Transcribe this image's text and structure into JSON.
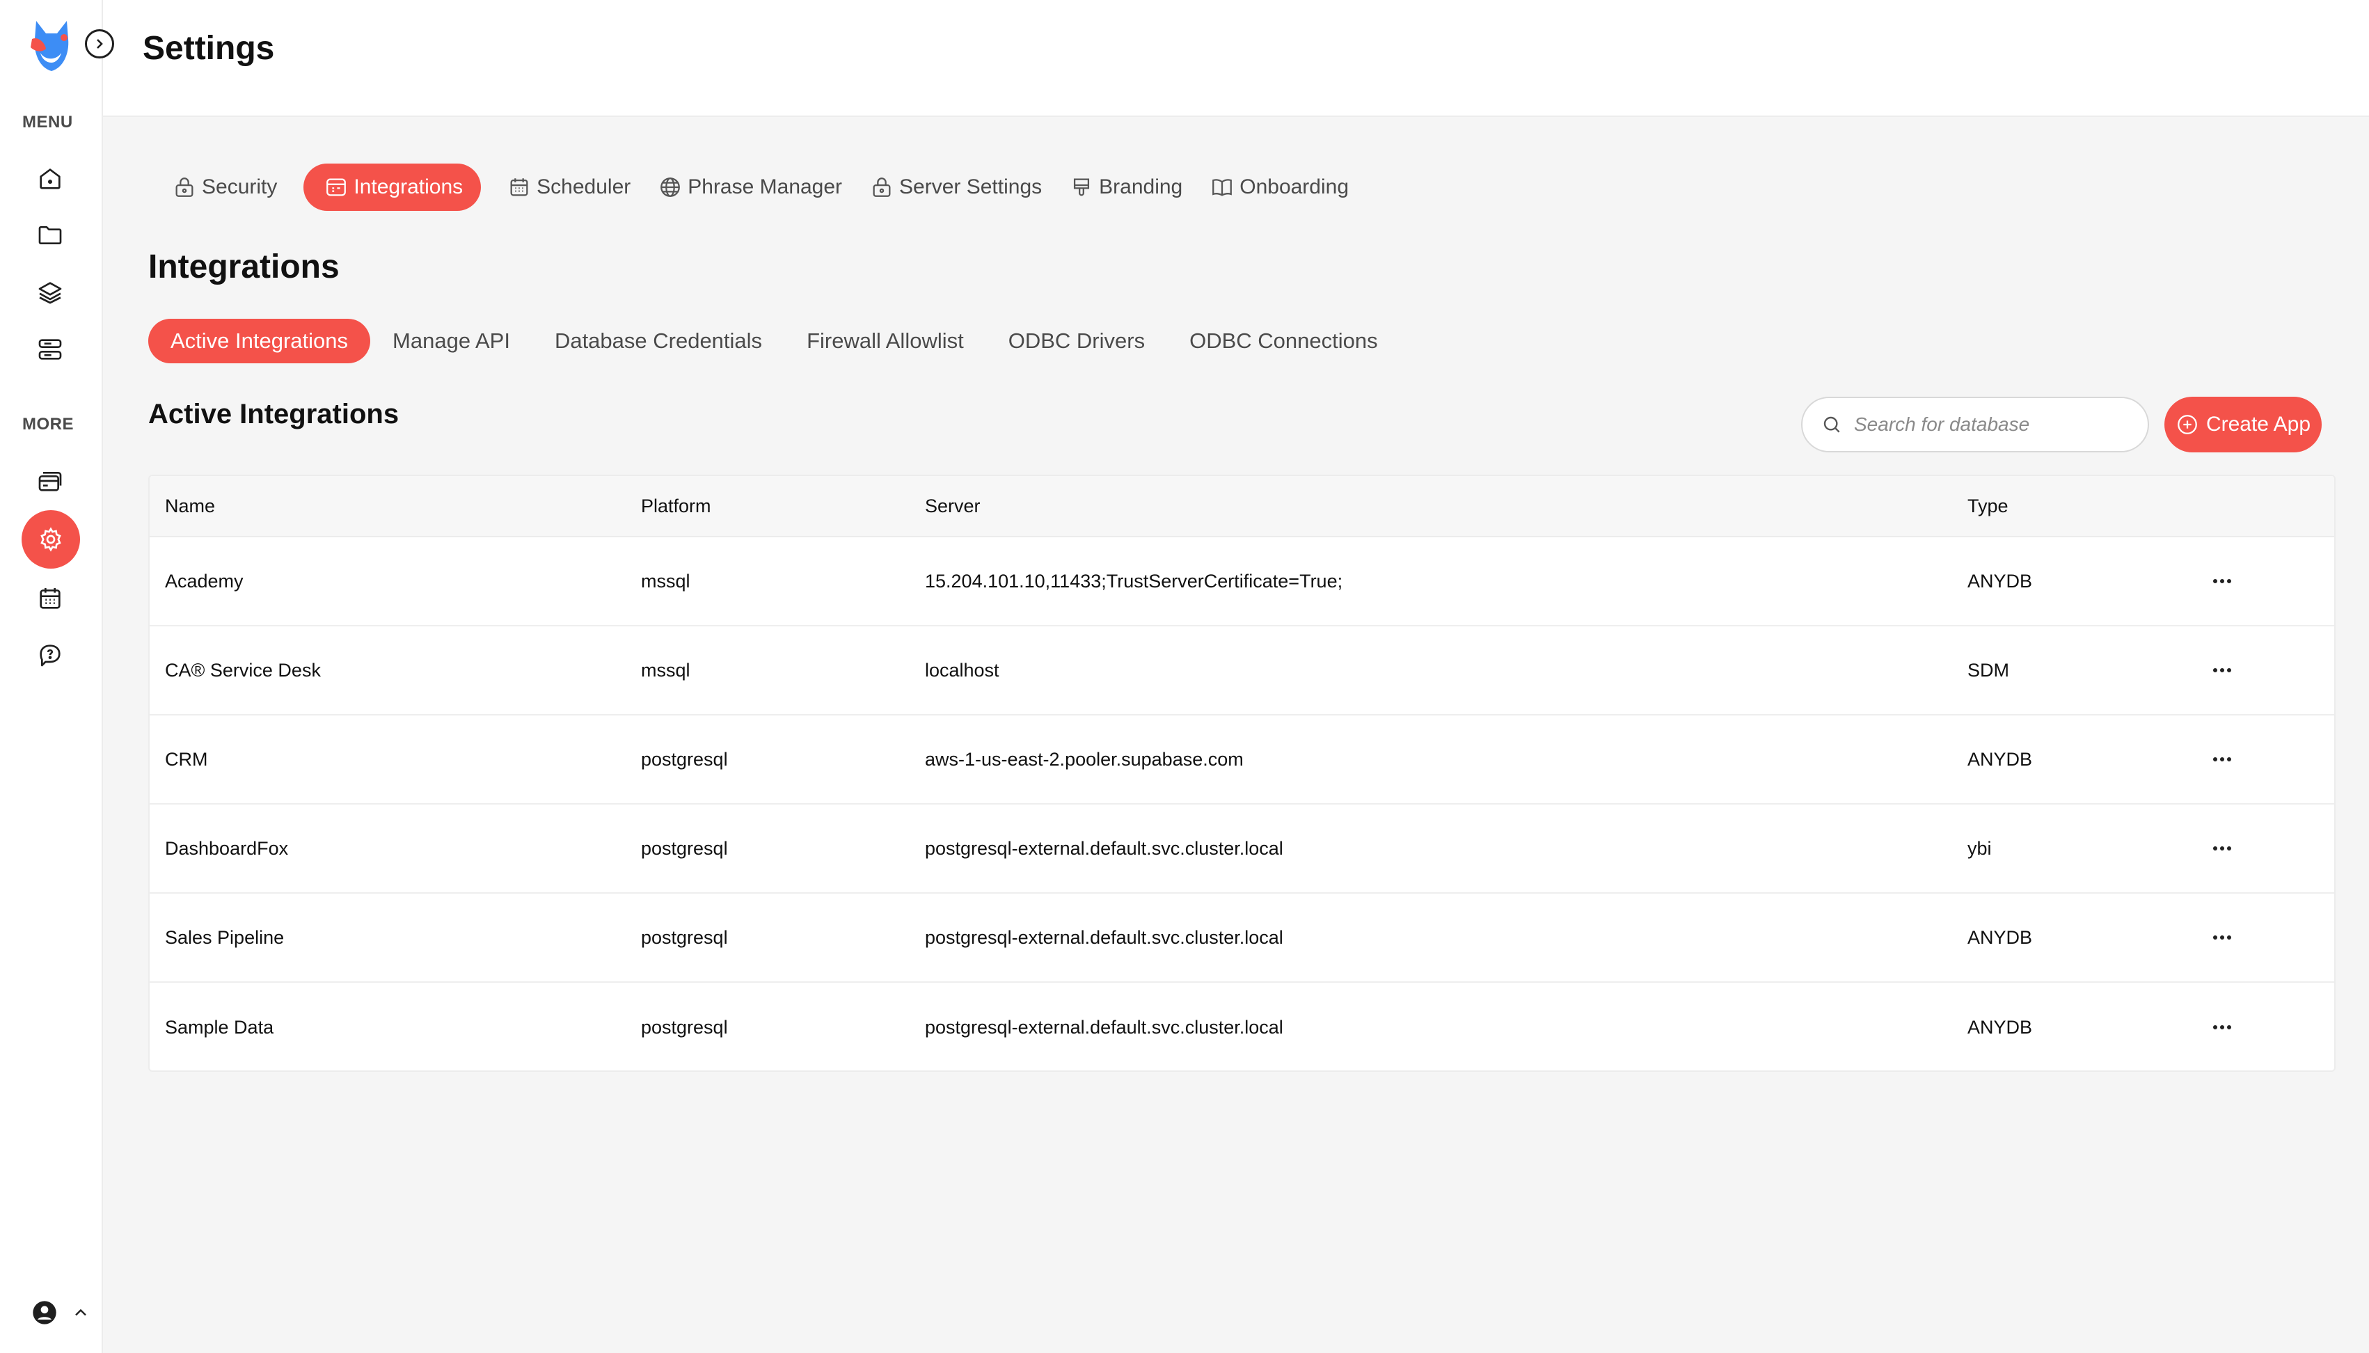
{
  "header": {
    "title": "Settings"
  },
  "sidebar": {
    "menu_label": "MENU",
    "more_label": "MORE",
    "menu_icons": [
      "home-icon",
      "folder-icon",
      "layers-icon",
      "server-icon"
    ],
    "more_icons": [
      "cards-icon",
      "settings-icon",
      "calendar-icon",
      "help-icon"
    ],
    "active_icon": "settings-icon",
    "accent": "#f4524a"
  },
  "top_tabs": [
    {
      "label": "Security",
      "icon": "lock-icon"
    },
    {
      "label": "Integrations",
      "icon": "integration-icon",
      "active": true
    },
    {
      "label": "Scheduler",
      "icon": "calendar-icon"
    },
    {
      "label": "Phrase Manager",
      "icon": "globe-icon"
    },
    {
      "label": "Server Settings",
      "icon": "lock-icon"
    },
    {
      "label": "Branding",
      "icon": "brush-icon"
    },
    {
      "label": "Onboarding",
      "icon": "book-icon"
    }
  ],
  "section_title": "Integrations",
  "sub_tabs": [
    {
      "label": "Active Integrations",
      "active": true
    },
    {
      "label": "Manage API"
    },
    {
      "label": "Database Credentials"
    },
    {
      "label": "Firewall Allowlist"
    },
    {
      "label": "ODBC Drivers"
    },
    {
      "label": "ODBC Connections"
    }
  ],
  "list_title": "Active Integrations",
  "search": {
    "placeholder": "Search for database"
  },
  "create_button": "Create App",
  "table": {
    "columns": [
      "Name",
      "Platform",
      "Server",
      "Type"
    ],
    "rows": [
      {
        "name": "Academy",
        "platform": "mssql",
        "server": "15.204.101.10,11433;TrustServerCertificate=True;",
        "type": "ANYDB"
      },
      {
        "name": "CA® Service Desk",
        "platform": "mssql",
        "server": "localhost",
        "type": "SDM"
      },
      {
        "name": "CRM",
        "platform": "postgresql",
        "server": "aws-1-us-east-2.pooler.supabase.com",
        "type": "ANYDB"
      },
      {
        "name": "DashboardFox",
        "platform": "postgresql",
        "server": "postgresql-external.default.svc.cluster.local",
        "type": "ybi"
      },
      {
        "name": "Sales Pipeline",
        "platform": "postgresql",
        "server": "postgresql-external.default.svc.cluster.local",
        "type": "ANYDB"
      },
      {
        "name": "Sample Data",
        "platform": "postgresql",
        "server": "postgresql-external.default.svc.cluster.local",
        "type": "ANYDB"
      }
    ]
  }
}
